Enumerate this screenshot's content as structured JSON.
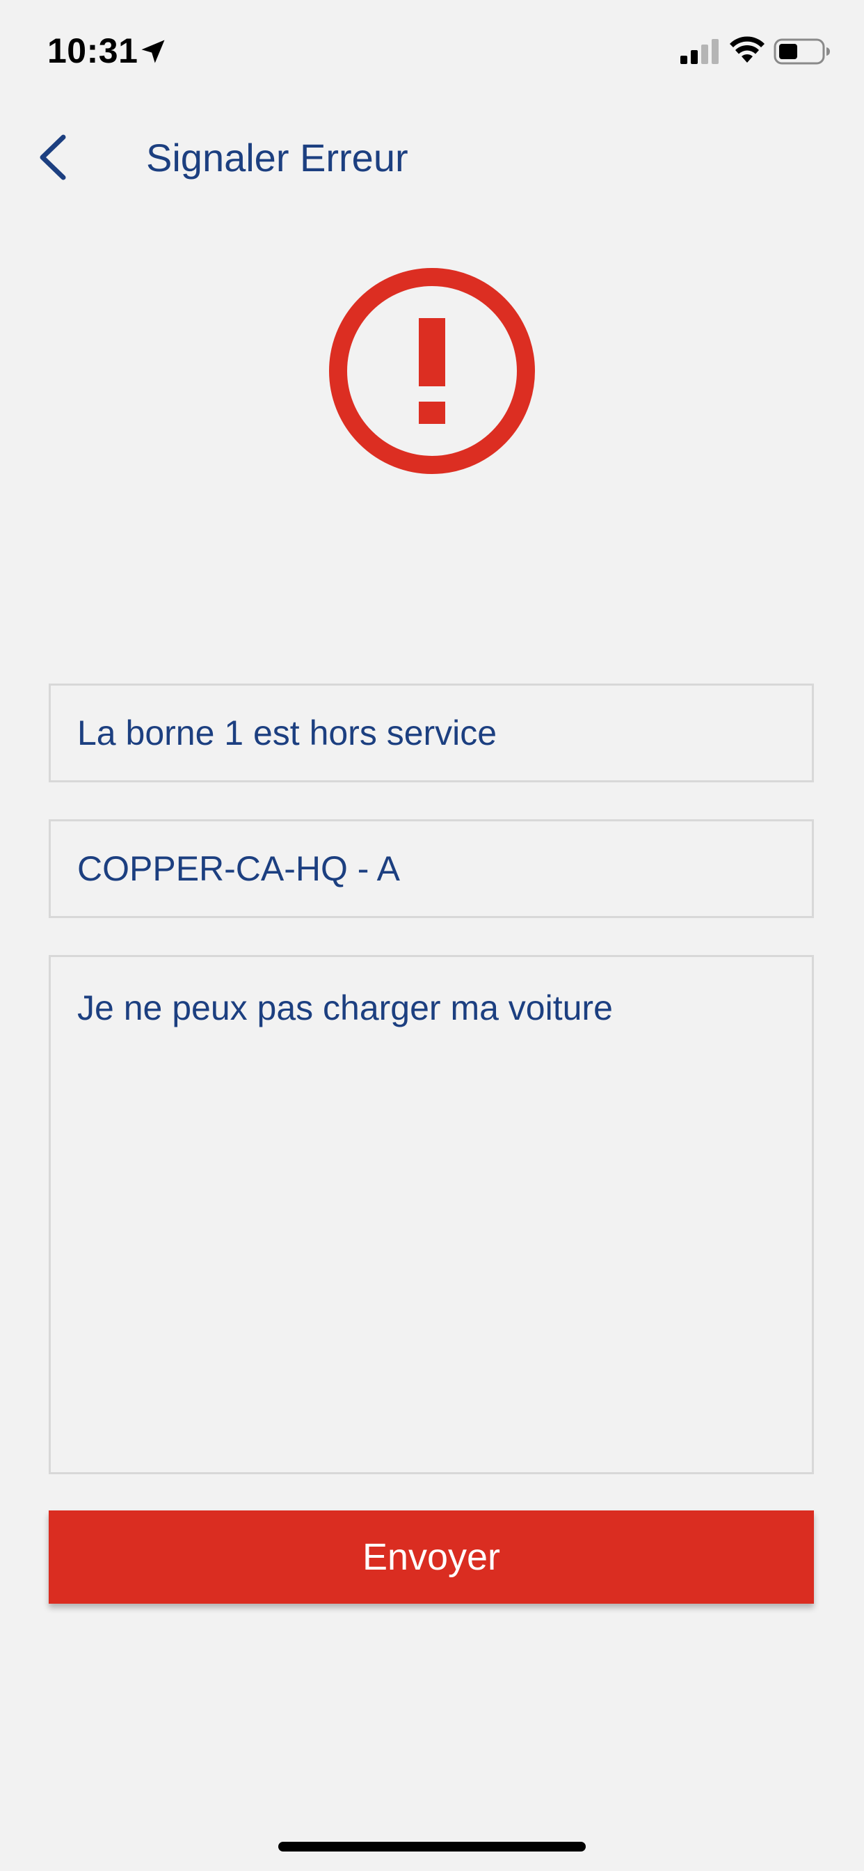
{
  "status_bar": {
    "time": "10:31",
    "icons": [
      "location-arrow-icon",
      "cellular-signal-icon",
      "wifi-icon",
      "battery-icon"
    ]
  },
  "nav": {
    "back_icon": "chevron-left-icon",
    "title": "Signaler Erreur"
  },
  "alert": {
    "icon": "exclamation-circle-icon",
    "color": "#dc2e22"
  },
  "form": {
    "title_value": "La borne 1 est hors service",
    "station_value": "COPPER-CA-HQ - A",
    "message_value": "Je ne peux pas charger ma voiture",
    "submit_label": "Envoyer"
  },
  "colors": {
    "accent": "#1c3f80",
    "danger": "#da2d21",
    "background": "#f2f2f2"
  }
}
